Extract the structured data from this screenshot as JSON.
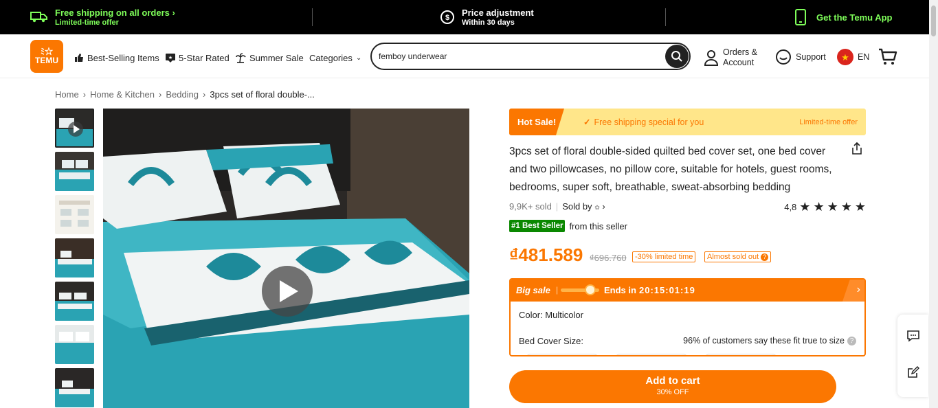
{
  "topbar": {
    "shipping_title": "Free shipping on all orders",
    "shipping_sub": "Limited-time offer",
    "price_title": "Price adjustment",
    "price_sub": "Within 30 days",
    "app_label": "Get the Temu App"
  },
  "header": {
    "logo_line1": "ﾐ☆",
    "logo_line2": "TEMU",
    "nav": [
      "Best-Selling Items",
      "5-Star Rated",
      "Summer Sale",
      "Categories"
    ],
    "search_value": "femboy underwear",
    "orders_line1": "Orders &",
    "orders_line2": "Account",
    "support": "Support",
    "lang": "EN"
  },
  "breadcrumb": [
    "Home",
    "Home & Kitchen",
    "Bedding",
    "3pcs set of floral double-..."
  ],
  "product": {
    "hot_sale": "Hot Sale!",
    "free_ship": "Free shipping special for you",
    "limited": "Limited-time offer",
    "title": "3pcs set of floral double-sided quilted bed cover set, one bed cover and two pillowcases, no pillow core, suitable for hotels, guest rooms, bedrooms, super soft, breathable, sweat-absorbing bedding",
    "sold": "9,9K+ sold",
    "sold_by": "Sold by",
    "rating": "4,8",
    "best_seller": "#1 Best Seller",
    "from_seller": "from this seller",
    "price": "₫481.589",
    "old_price": "₫696.760",
    "discount": "-30% limited time",
    "almost": "Almost sold out",
    "big_sale": "Big sale",
    "ends_in": "Ends in",
    "countdown": "20:15:01:19",
    "color_label": "Color: Multicolor",
    "size_label": "Bed Cover Size:",
    "fit_note": "96% of customers say these fit true to size",
    "add_to_cart": "Add to cart",
    "cart_off": "30% OFF"
  },
  "colors": {
    "accent": "#fb7701",
    "green": "#0a8800",
    "highlight": "#7fff5a",
    "teal": "#2aa3b3"
  }
}
